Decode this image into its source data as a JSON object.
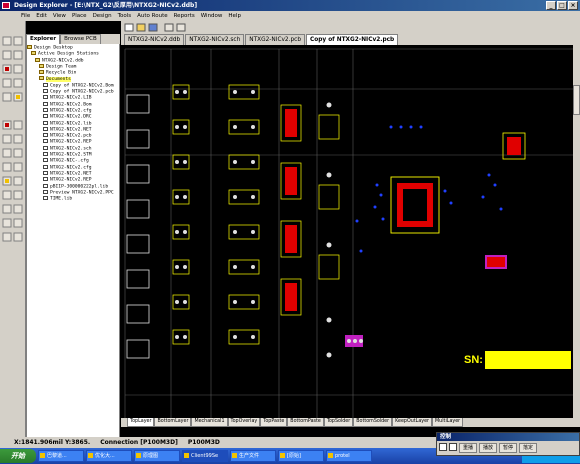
{
  "window": {
    "title": "Design Explorer - [E:\\NTX_G2\\反厚用\\NTXG2-NICv2.ddb]"
  },
  "menu": [
    "File",
    "Edit",
    "View",
    "Place",
    "Design",
    "Tools",
    "Auto Route",
    "Reports",
    "Window",
    "Help"
  ],
  "explorer": {
    "tabs": [
      "Explorer",
      "Browse PCB"
    ],
    "tree": [
      "Design Desktop",
      "Active Design Stations",
      "NTXG2-NICv2.ddb",
      "Design Team",
      "Recycle Bin",
      "Documents",
      "Copy of NTXG2-NICv2.Bom",
      "Copy of NTXG2-NICv2.pcb",
      "NTXG2-NICv2.LIB",
      "NTXG2-NICv2.Bom",
      "NTXG2-NICv2.cfg",
      "NTXG2-NICv2.DRC",
      "NTXG2-NICv2.lib",
      "NTXG2-NICv2.NET",
      "NTXG2-NICv2.pcb",
      "NTXG2-NICv2.REP",
      "NTXG2-NICv2.sch",
      "NTXG2-NICv2.STM",
      "NTXG2-NIC-.cfg",
      "NTXG2-NICv2.cfg",
      "NTXG2-NICv2.NET",
      "NTXG2-NICv2.REP",
      "pBIIP-300000222pl.lib",
      "Preview NTXG2-NICv2.PPC",
      "TIME.lib"
    ]
  },
  "doc_tabs": [
    "NTXG2-NICv2.ddb",
    "NTXG2-NICv2.sch",
    "NTXG2-NICv2.pcb",
    "Copy of NTXG2-NICv2.pcb"
  ],
  "layer_tabs": [
    "TopLayer",
    "BottomLayer",
    "Mechanical1",
    "TopOverlay",
    "TopPaste",
    "BottomPaste",
    "TopSolder",
    "BottomSolder",
    "KeepOutLayer",
    "MultiLayer"
  ],
  "canvas": {
    "sn_label": "SN:"
  },
  "status": {
    "coords": "X:1841.906mil Y:3865.",
    "connection": "Connection [P100M3D]",
    "component": "P100M3D"
  },
  "control_panel": {
    "title": "控制",
    "buttons": [
      "重播",
      "播放",
      "暂停",
      "落定"
    ]
  },
  "taskbar": {
    "start": "开始",
    "tasks": [
      "巴黎道...",
      "优化大...",
      "原理图",
      "Client99Se",
      "生产文件",
      "[原始]",
      "protel"
    ],
    "clock": ""
  },
  "colors": {
    "silkscreen": "#ffff00",
    "copper_top": "#e00000",
    "via": "#2040ff",
    "board_grid": "#707070",
    "highlight": "#c020c0"
  }
}
